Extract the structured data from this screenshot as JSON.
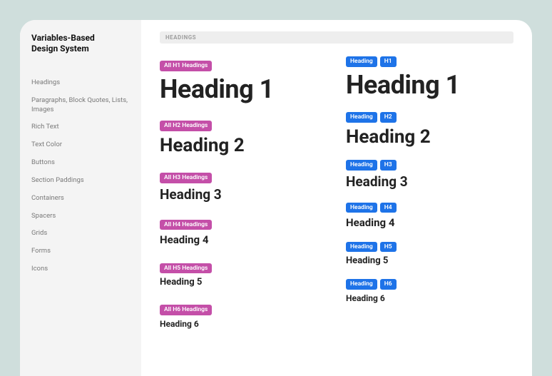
{
  "brand": {
    "line1": "Variables-Based",
    "line2": "Design System"
  },
  "sidebar": {
    "items": [
      {
        "label": "Headings"
      },
      {
        "label": "Paragraphs, Block Quotes, Lists, Images"
      },
      {
        "label": "Rich Text"
      },
      {
        "label": "Text Color"
      },
      {
        "label": "Buttons"
      },
      {
        "label": "Section Paddings"
      },
      {
        "label": "Containers"
      },
      {
        "label": "Spacers"
      },
      {
        "label": "Grids"
      },
      {
        "label": "Forms"
      },
      {
        "label": "Icons"
      }
    ]
  },
  "section": {
    "title": "HEADINGS"
  },
  "left": {
    "items": [
      {
        "badge": "All H1 Headings",
        "text": "Heading 1",
        "cls": "h1"
      },
      {
        "badge": "All H2 Headings",
        "text": "Heading 2",
        "cls": "h2"
      },
      {
        "badge": "All H3 Headings",
        "text": "Heading 3",
        "cls": "h3"
      },
      {
        "badge": "All H4 Headings",
        "text": "Heading 4",
        "cls": "h4"
      },
      {
        "badge": "All H5 Headings",
        "text": "Heading 5",
        "cls": "h5"
      },
      {
        "badge": "All H6 Headings",
        "text": "Heading 6",
        "cls": "h6"
      }
    ]
  },
  "right": {
    "items": [
      {
        "badge1": "Heading",
        "badge2": "H1",
        "text": "Heading 1",
        "cls": "h1"
      },
      {
        "badge1": "Heading",
        "badge2": "H2",
        "text": "Heading 2",
        "cls": "h2"
      },
      {
        "badge1": "Heading",
        "badge2": "H3",
        "text": "Heading 3",
        "cls": "h3"
      },
      {
        "badge1": "Heading",
        "badge2": "H4",
        "text": "Heading 4",
        "cls": "h4"
      },
      {
        "badge1": "Heading",
        "badge2": "H5",
        "text": "Heading 5",
        "cls": "h5"
      },
      {
        "badge1": "Heading",
        "badge2": "H6",
        "text": "Heading 6",
        "cls": "h6"
      }
    ]
  }
}
